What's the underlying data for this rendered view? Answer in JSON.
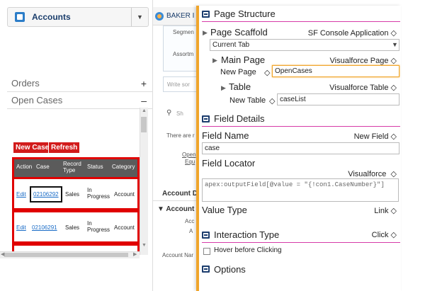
{
  "left": {
    "header_title": "Accounts",
    "orders_label": "Orders",
    "open_cases_label": "Open Cases",
    "new_case_label": "New Case",
    "refresh_label": "Refresh",
    "columns": [
      "Action",
      "Case",
      "Record Type",
      "Status",
      "Category"
    ],
    "rows": [
      {
        "action": "Edit",
        "case": "02106292",
        "record_type": "Sales",
        "status": "In Progress",
        "category": "Account"
      },
      {
        "action": "Edit",
        "case": "02106291",
        "record_type": "Sales",
        "status": "In Progress",
        "category": "Account"
      }
    ]
  },
  "middle": {
    "tab_label": "BAKER I",
    "segment": "Segmen",
    "assortm": "Assortm",
    "write": "Write sor",
    "search": "Sh",
    "there_are": "There are r",
    "open": "Open",
    "equ": "Equ",
    "account_d": "Account D",
    "account_section": "Account",
    "acc": "Acc",
    "a": "A",
    "account_nar": "Account Nar"
  },
  "panel": {
    "page_structure_title": "Page Structure",
    "page_scaffold_label": "Page Scaffold",
    "page_scaffold_value": "SF Console Application",
    "current_tab": "Current Tab",
    "main_page_label": "Main Page",
    "main_page_value": "Visualforce Page",
    "new_page_label": "New Page",
    "new_page_value": "OpenCases",
    "table_label": "Table",
    "table_value": "Visualforce Table",
    "new_table_label": "New Table",
    "new_table_value": "caseList",
    "field_details_title": "Field Details",
    "field_name_label": "Field Name",
    "field_name_value": "New Field",
    "field_name_input": "case",
    "field_locator_label": "Field Locator",
    "field_locator_type": "Visualforce",
    "field_locator_value": "apex:outputField[@value = \"{!con1.CaseNumber}\"]",
    "value_type_label": "Value Type",
    "value_type_value": "Link",
    "interaction_type_label": "Interaction Type",
    "interaction_type_value": "Click",
    "hover_label": "Hover before Clicking",
    "options_label": "Options"
  },
  "colors": {
    "accent": "#f0a52b",
    "highlight": "#e00000",
    "divider": "#d63ca8",
    "link": "#1a6cc7"
  }
}
